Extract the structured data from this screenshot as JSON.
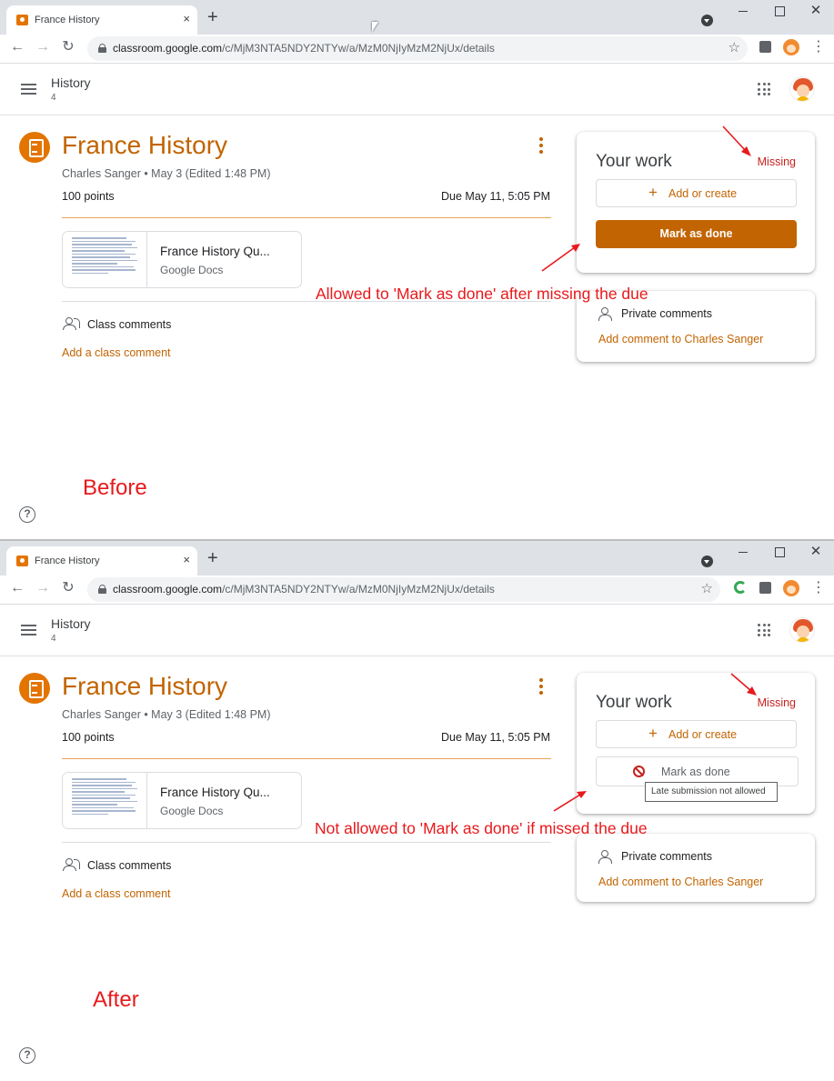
{
  "browser": {
    "tab_title": "France History",
    "tab_close": "×",
    "new_tab": "+",
    "url_host": "classroom.google.com",
    "url_path": "/c/MjM3NTA5NDY2NTYw/a/MzM0NjIyMzM2NjUx/details"
  },
  "header": {
    "class_name": "History",
    "class_section": "4"
  },
  "assignment": {
    "title": "France History",
    "meta": "Charles Sanger • May 3 (Edited 1:48 PM)",
    "points": "100 points",
    "due": "Due May 11, 5:05 PM",
    "attachment_title": "France History Qu...",
    "attachment_type": "Google Docs",
    "class_comments": "Class comments",
    "add_class_comment": "Add a class comment"
  },
  "your_work": {
    "title": "Your work",
    "status": "Missing",
    "add_or_create": "Add or create",
    "mark_as_done": "Mark as done",
    "tooltip": "Late submission not allowed"
  },
  "private_comments": {
    "title": "Private comments",
    "add_link": "Add comment to Charles Sanger"
  },
  "help": "?",
  "annotations": {
    "before_note": "Allowed to 'Mark as done' after missing the due",
    "before_label": "Before",
    "after_note": "Not allowed to 'Mark as done' if missed the due",
    "after_label": "After"
  },
  "colors": {
    "accent": "#c26401",
    "missing": "#c5221f",
    "annotation": "#e8191c"
  }
}
